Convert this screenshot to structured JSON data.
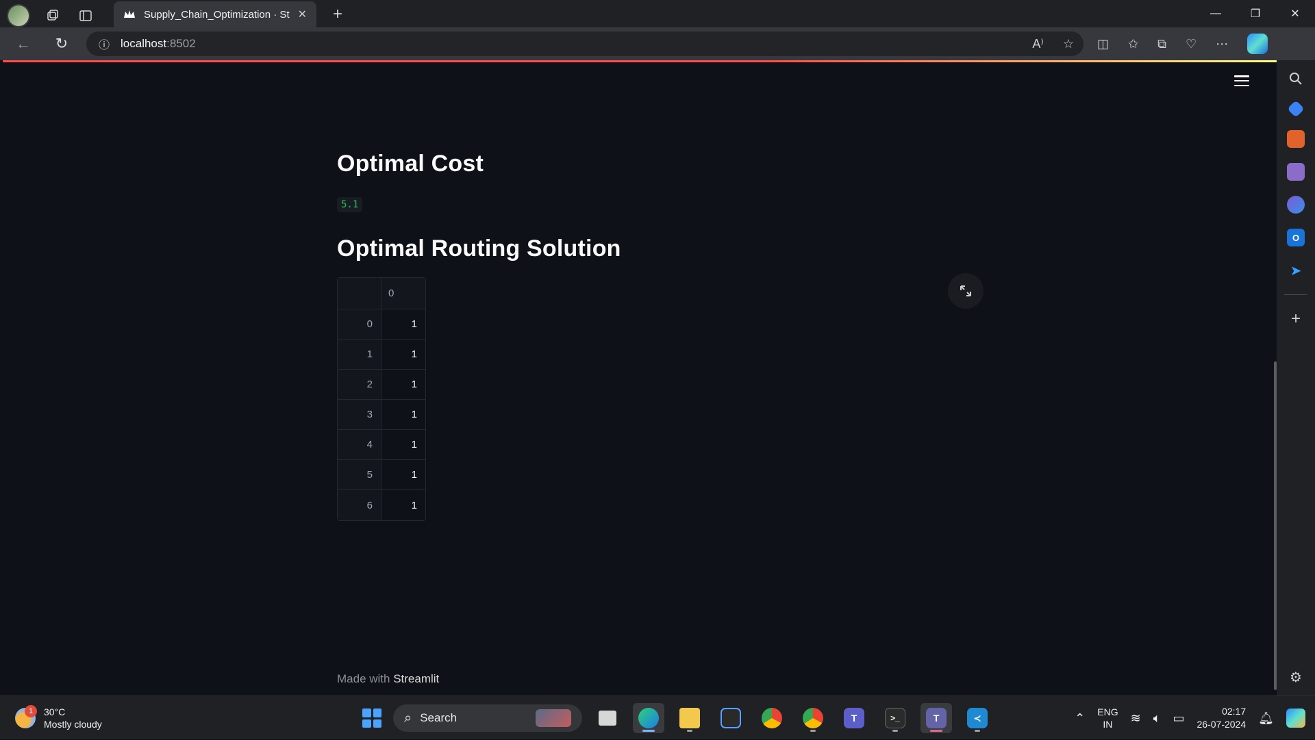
{
  "browser": {
    "tab_title": "Supply_Chain_Optimization · Stre",
    "url_host": "localhost",
    "url_port": ":8502"
  },
  "page": {
    "heading_cost": "Optimal Cost",
    "cost_value": "5.1",
    "heading_routing": "Optimal Routing Solution",
    "table": {
      "columns": [
        "0"
      ],
      "rows": [
        {
          "index": "0",
          "value": "1"
        },
        {
          "index": "1",
          "value": "1"
        },
        {
          "index": "2",
          "value": "1"
        },
        {
          "index": "3",
          "value": "1"
        },
        {
          "index": "4",
          "value": "1"
        },
        {
          "index": "5",
          "value": "1"
        },
        {
          "index": "6",
          "value": "1"
        }
      ]
    },
    "footer_prefix": "Made with ",
    "footer_brand": "Streamlit"
  },
  "taskbar": {
    "weather_temp": "30°C",
    "weather_desc": "Mostly cloudy",
    "weather_badge": "1",
    "search_label": "Search",
    "lang_top": "ENG",
    "lang_bottom": "IN",
    "time": "02:17",
    "date": "26-07-2024"
  },
  "colors": {
    "app_bg": "#0e1117",
    "accent_red": "#ff4b4b",
    "code_green": "#21c354"
  }
}
